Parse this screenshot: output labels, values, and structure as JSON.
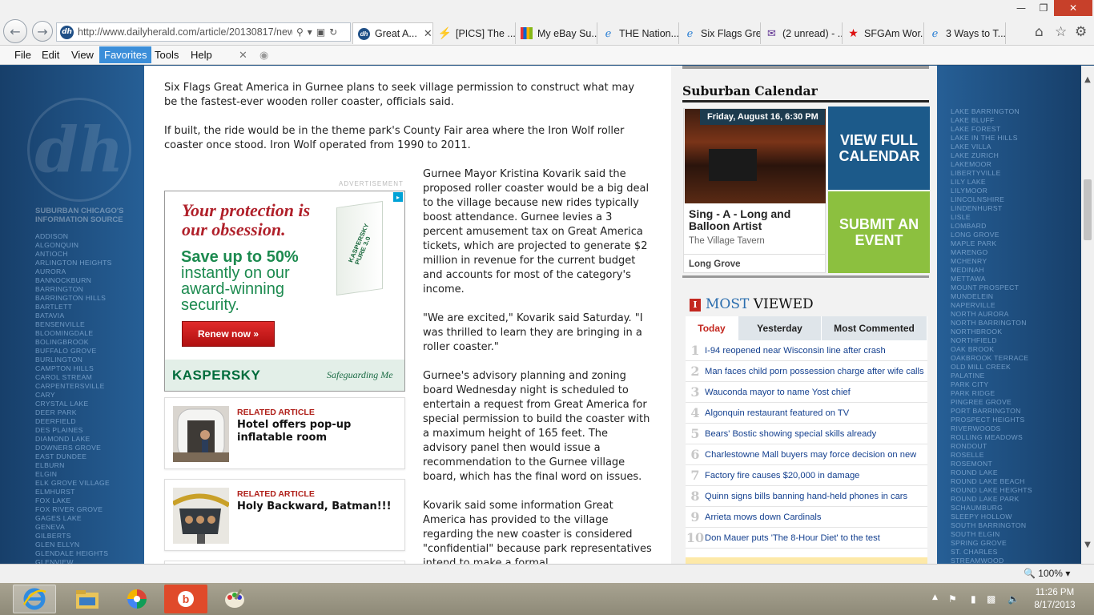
{
  "browser": {
    "address": "http://www.dailyherald.com/article/20130817/news",
    "address_domain": "dailyherald.com",
    "favicon": "dh",
    "tabs": [
      {
        "label": "Great A...",
        "icon": "dh-icon",
        "active": true
      },
      {
        "label": "[PICS] The ...",
        "icon": "bolt-icon"
      },
      {
        "label": "My eBay Su...",
        "icon": "ebay-icon"
      },
      {
        "label": "THE Nation...",
        "icon": "ie-page-icon"
      },
      {
        "label": "Six Flags Gre...",
        "icon": "ie-page-icon"
      },
      {
        "label": "(2 unread) - ...",
        "icon": "mail-icon"
      },
      {
        "label": "SFGAm Wor...",
        "icon": "star-icon"
      },
      {
        "label": "3 Ways to T...",
        "icon": "ie-page-icon"
      }
    ],
    "menu": [
      "File",
      "Edit",
      "View",
      "Favorites",
      "Tools",
      "Help"
    ],
    "selected_menu": "Favorites",
    "zoom": "100%"
  },
  "left_panel": {
    "logo": "dh",
    "tagline": "SUBURBAN CHICAGO'S INFORMATION SOURCE",
    "towns": [
      "ADDISON",
      "ALGONQUIN",
      "ANTIOCH",
      "ARLINGTON HEIGHTS",
      "AURORA",
      "BANNOCKBURN",
      "BARRINGTON",
      "BARRINGTON HILLS",
      "BARTLETT",
      "BATAVIA",
      "BENSENVILLE",
      "BLOOMINGDALE",
      "BOLINGBROOK",
      "BUFFALO GROVE",
      "BURLINGTON",
      "CAMPTON HILLS",
      "CAROL STREAM",
      "CARPENTERSVILLE",
      "CARY",
      "CRYSTAL LAKE",
      "DEER PARK",
      "DEERFIELD",
      "DES PLAINES",
      "DIAMOND LAKE",
      "DOWNERS GROVE",
      "EAST DUNDEE",
      "ELBURN",
      "ELGIN",
      "ELK GROVE VILLAGE",
      "ELMHURST",
      "FOX LAKE",
      "FOX RIVER GROVE",
      "GAGES LAKE",
      "GENEVA",
      "GILBERTS",
      "GLEN ELLYN",
      "GLENDALE HEIGHTS",
      "GLENVIEW"
    ]
  },
  "right_panel": {
    "towns": [
      "LAKE BARRINGTON",
      "LAKE BLUFF",
      "LAKE FOREST",
      "LAKE IN THE HILLS",
      "LAKE VILLA",
      "LAKE ZURICH",
      "LAKEMOOR",
      "LIBERTYVILLE",
      "LILY LAKE",
      "LILYMOOR",
      "LINCOLNSHIRE",
      "LINDENHURST",
      "LISLE",
      "LOMBARD",
      "LONG GROVE",
      "MAPLE PARK",
      "MARENGO",
      "MCHENRY",
      "MEDINAH",
      "METTAWA",
      "MOUNT PROSPECT",
      "MUNDELEIN",
      "NAPERVILLE",
      "NORTH AURORA",
      "NORTH BARRINGTON",
      "NORTHBROOK",
      "NORTHFIELD",
      "OAK BROOK",
      "OAKBROOK TERRACE",
      "OLD MILL CREEK",
      "PALATINE",
      "PARK CITY",
      "PARK RIDGE",
      "PINGREE GROVE",
      "PORT BARRINGTON",
      "PROSPECT HEIGHTS",
      "RIVERWOODS",
      "ROLLING MEADOWS",
      "RONDOUT",
      "ROSELLE",
      "ROSEMONT",
      "ROUND LAKE",
      "ROUND LAKE BEACH",
      "ROUND LAKE HEIGHTS",
      "ROUND LAKE PARK",
      "SCHAUMBURG",
      "SLEEPY HOLLOW",
      "SOUTH BARRINGTON",
      "SOUTH ELGIN",
      "SPRING GROVE",
      "ST. CHARLES",
      "STREAMWOOD"
    ]
  },
  "article": {
    "p1": "Six Flags Great America in Gurnee plans to seek village permission to construct what may be the fastest-ever wooden roller coaster, officials said.",
    "p2": "If built, the ride would be in the theme park's County Fair area where the Iron Wolf roller coaster once stood. Iron Wolf operated from 1990 to 2011.",
    "col": [
      "Gurnee Mayor Kristina Kovarik said the proposed roller coaster would be a big deal to the village because new rides typically boost attendance. Gurnee levies a 3 percent amusement tax on Great America tickets, which are projected to generate $2 million in revenue for the current budget and accounts for most of the category's income.",
      "\"We are excited,\" Kovarik said Saturday. \"I was thrilled to learn they are bringing in a roller coaster.\"",
      "Gurnee's advisory planning and zoning board Wednesday night is scheduled to entertain a request from Great America for special permission to build the coaster with a maximum height of 165 feet. The advisory panel then would issue a recommendation to the Gurnee village board, which has the final word on issues.",
      "Kovarik said some information Great America has provided to the village regarding the new coaster is considered \"confidential\" because park representatives intend to make a formal"
    ]
  },
  "ad": {
    "label": "ADVERTISEMENT",
    "headline": "Your protection is our obsession.",
    "offer_bold": "Save up to 50%",
    "offer_rest": "instantly on our award-winning security.",
    "button": "Renew now »",
    "box_text": "KASPERSKY PURE 3.0",
    "brand": "KASPERSKY",
    "slogan": "Safeguarding Me"
  },
  "related": [
    {
      "kicker": "RELATED ARTICLE",
      "title": "Hotel offers pop-up inflatable room"
    },
    {
      "kicker": "RELATED ARTICLE",
      "title": "Holy Backward, Batman!!!"
    }
  ],
  "calendar": {
    "heading": "Suburban Calendar",
    "event_date": "Friday, August 16, 6:30 PM",
    "event_title": "Sing - A - Long and Balloon Artist",
    "event_venue": "The Village Tavern",
    "event_town": "Long Grove",
    "view_button": "VIEW FULL CALENDAR",
    "submit_button": "SUBMIT AN EVENT"
  },
  "most_viewed": {
    "heading_1": "MOST",
    "heading_2": "VIEWED",
    "tabs": [
      "Today",
      "Yesterday",
      "Most Commented"
    ],
    "active_tab": "Today",
    "items": [
      {
        "num": "1",
        "text": "I-94 reopened near Wisconsin line after crash"
      },
      {
        "num": "2",
        "text": "Man faces child porn possession charge after wife calls"
      },
      {
        "num": "3",
        "text": "Wauconda mayor to name Yost chief"
      },
      {
        "num": "4",
        "text": "Algonquin restaurant featured on TV"
      },
      {
        "num": "5",
        "text": "Bears' Bostic showing special skills already"
      },
      {
        "num": "6",
        "text": "Charlestowne Mall buyers may force decision on new"
      },
      {
        "num": "7",
        "text": "Factory fire causes $20,000 in damage"
      },
      {
        "num": "8",
        "text": "Quinn signs bills banning hand-held phones in cars"
      },
      {
        "num": "9",
        "text": "Arrieta mows down Cardinals"
      },
      {
        "num": "10",
        "text": "Don Mauer puts 'The 8-Hour Diet' to the test"
      }
    ]
  },
  "taskbar": {
    "time": "11:26 PM",
    "date": "8/17/2013"
  }
}
